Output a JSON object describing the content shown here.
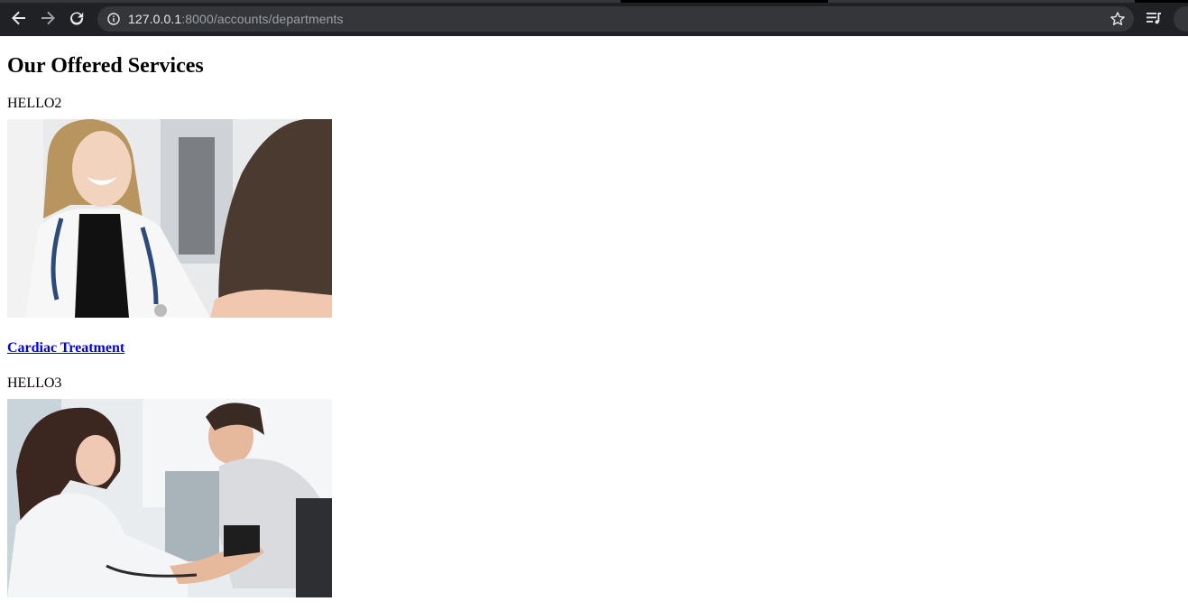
{
  "browser": {
    "url_host": "127.0.0.1",
    "url_rest": ":8000/accounts/departments",
    "icons": [
      "back-arrow-icon",
      "forward-arrow-icon",
      "reload-icon",
      "info-icon",
      "star-icon",
      "media-playlist-icon",
      "profile-icon"
    ]
  },
  "page": {
    "title": "Our Offered Services",
    "departments": [
      {
        "label": "HELLO2",
        "name": "Cardiac Treatment"
      },
      {
        "label": "HELLO3"
      }
    ]
  },
  "colors": {
    "chrome_bg": "#202124",
    "omnibox_bg": "#35363a",
    "link": "#0000ee"
  }
}
